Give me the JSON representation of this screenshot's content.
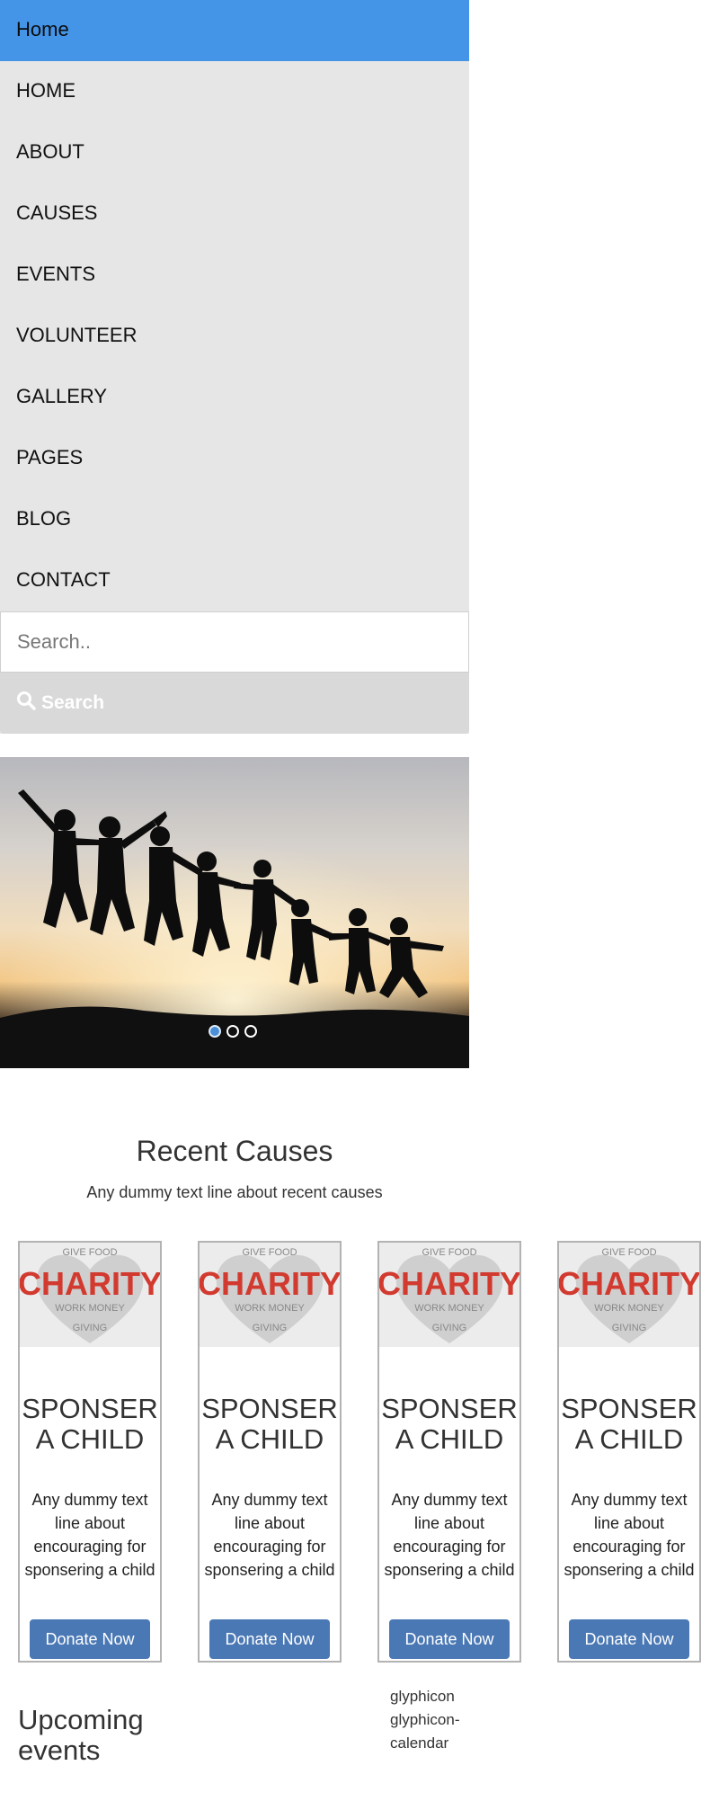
{
  "nav": {
    "items": [
      {
        "label": "Home"
      },
      {
        "label": "HOME"
      },
      {
        "label": "ABOUT"
      },
      {
        "label": "CAUSES"
      },
      {
        "label": "EVENTS"
      },
      {
        "label": "VOLUNTEER"
      },
      {
        "label": "GALLERY"
      },
      {
        "label": "PAGES"
      },
      {
        "label": "BLOG"
      },
      {
        "label": "CONTACT"
      }
    ],
    "active_color": "#4495e8"
  },
  "search": {
    "placeholder": "Search..",
    "value": "",
    "button_label": "Search",
    "icon": "search-icon"
  },
  "hero": {
    "slide_count": 3,
    "active_slide": 1
  },
  "causes": {
    "title": "Recent Causes",
    "subtitle": "Any dummy text line about recent causes",
    "cards": [
      {
        "image_words": "CHARITY",
        "title": "SPONSER A CHILD",
        "text": "Any dummy text line about encouraging for sponsering a child",
        "button": "Donate Now"
      },
      {
        "image_words": "CHARITY",
        "title": "SPONSER A CHILD",
        "text": "Any dummy text line about encouraging for sponsering a child",
        "button": "Donate Now"
      },
      {
        "image_words": "CHARITY",
        "title": "SPONSER A CHILD",
        "text": "Any dummy text line about encouraging for sponsering a child",
        "button": "Donate Now"
      },
      {
        "image_words": "CHARITY",
        "title": "SPONSER A CHILD",
        "text": "Any dummy text line about encouraging for sponsering a child",
        "button": "Donate Now"
      }
    ],
    "button_color": "#4a78b4"
  },
  "events": {
    "title": "Upcoming events",
    "icon_text": "glyphicon glyphicon-calendar"
  }
}
